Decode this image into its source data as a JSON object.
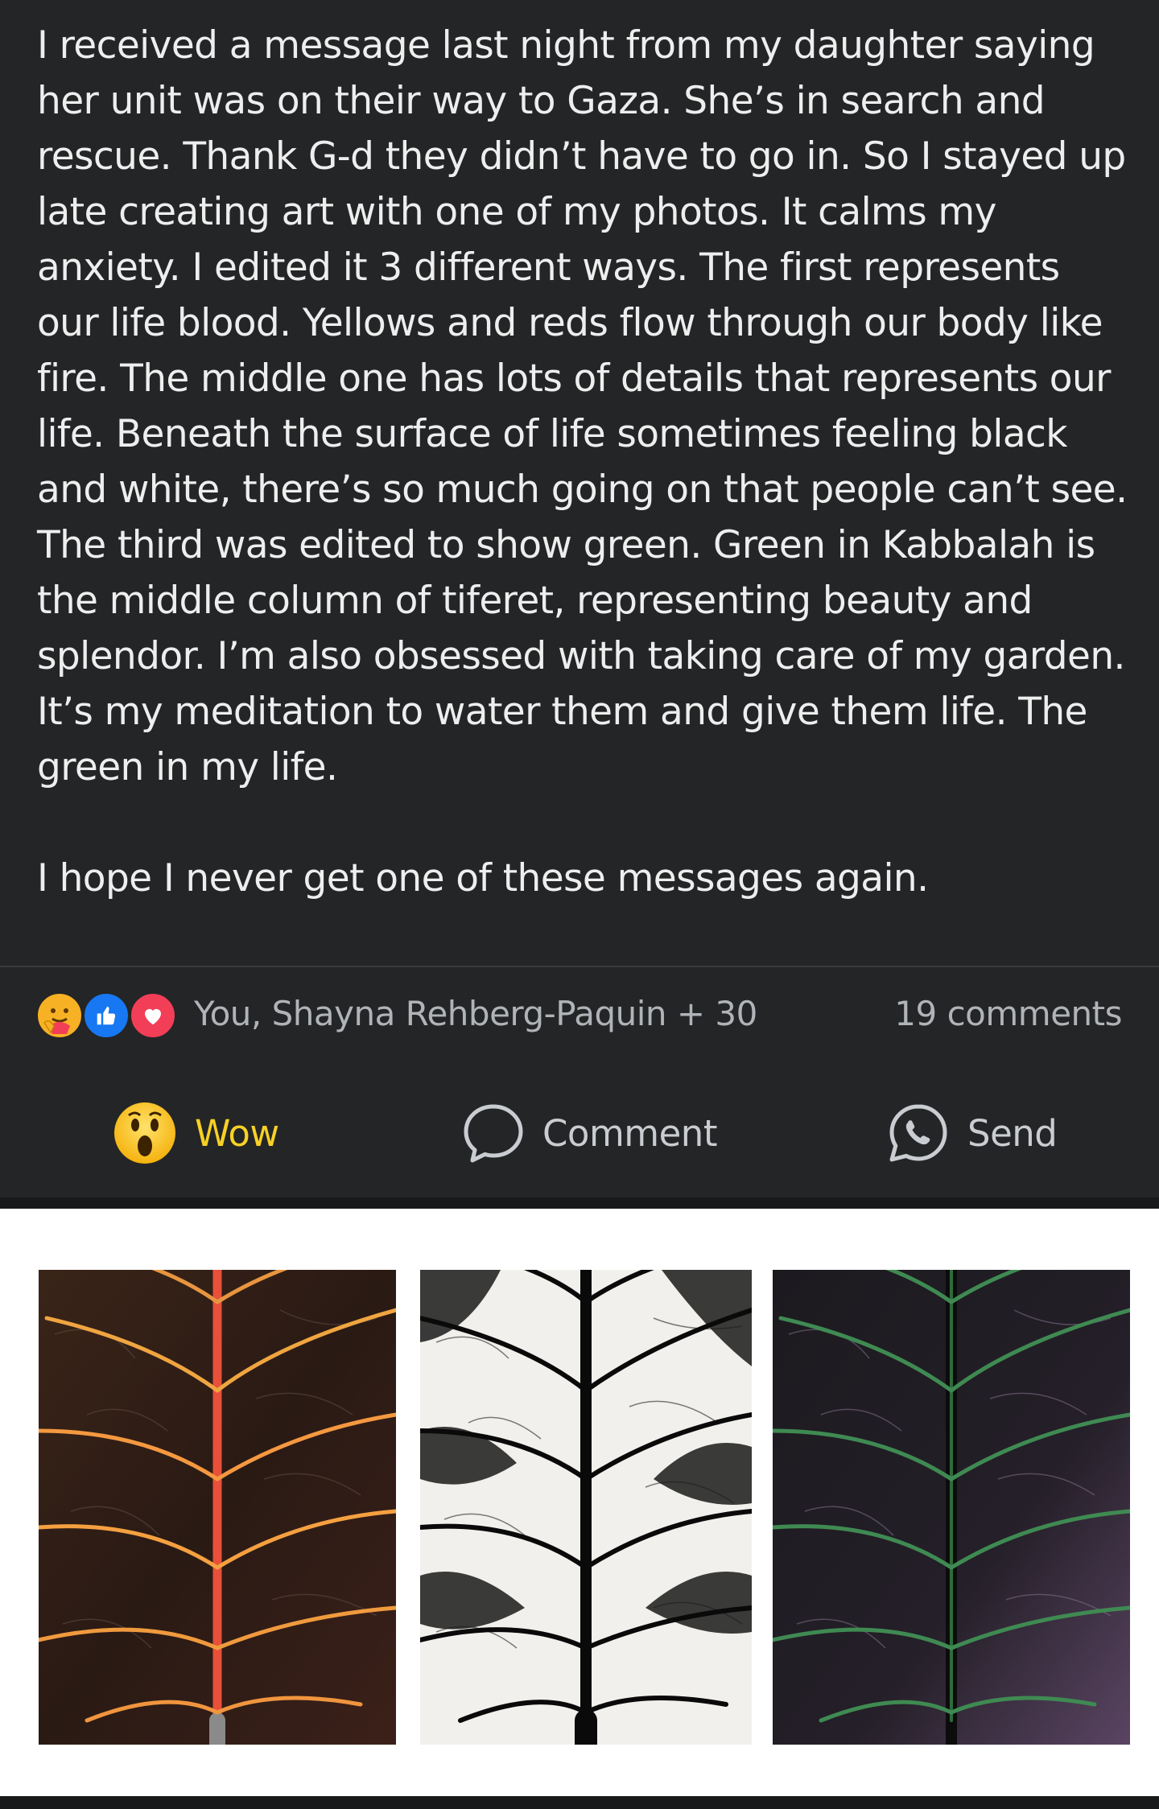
{
  "post": {
    "paragraph_1": "I received a message last night from my daughter saying her unit was on their way to Gaza. She’s in search and rescue. Thank G-d they didn’t have to go in. So I stayed up late creating art with one of my photos. It calms my anxiety. I edited it 3 different ways. The first represents our life blood. Yellows and reds flow through our body like fire. The middle one has lots of details that represents our life. Beneath the surface of life sometimes feeling black and white, there’s so much going on that people can’t see. The third was edited to show green. Green in Kabbalah is the middle column of tiferet, representing beauty and splendor. I’m also obsessed with taking care of my garden. It’s my meditation to water them and give them life. The green in my life.",
    "paragraph_2": "I hope I never get one of these messages again."
  },
  "reactions": {
    "icons": [
      "care-icon",
      "like-icon",
      "love-icon"
    ],
    "names": "You, Shayna Rehberg-Paquin + 30",
    "comments": "19 comments"
  },
  "actions": {
    "wow": "Wow",
    "comment": "Comment",
    "send": "Send"
  },
  "colors": {
    "background": "#242526",
    "wow_accent": "#f7d125",
    "like_blue": "#1877f2",
    "love_red": "#f33e58"
  }
}
